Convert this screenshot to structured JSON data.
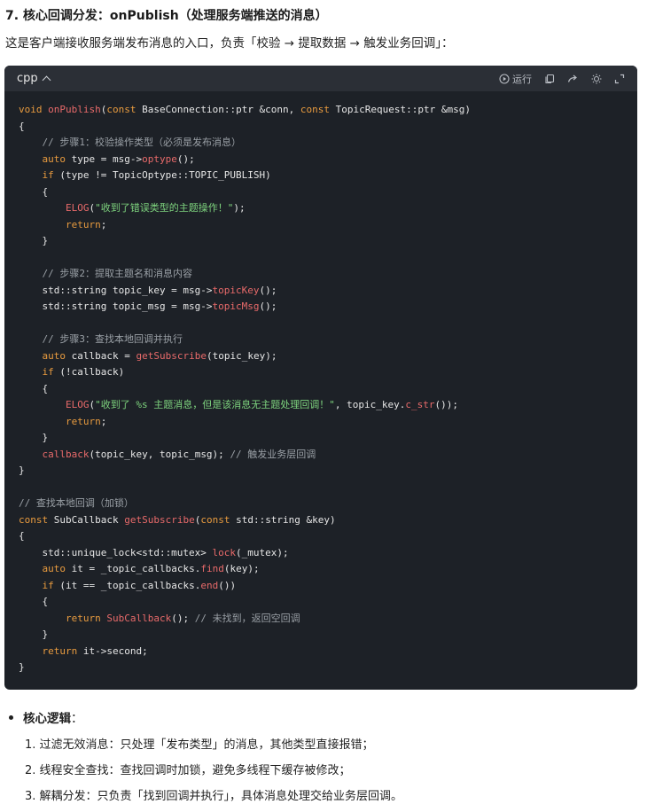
{
  "heading": "7. 核心回调分发：onPublish（处理服务端推送的消息）",
  "intro": "这是客户端接收服务端发布消息的入口，负责「校验 → 提取数据 → 触发业务回调」：",
  "code_block": {
    "language": "cpp",
    "toolbar": {
      "run_label": "运行",
      "icons": [
        "play-circle-icon",
        "copy-icon",
        "share-icon",
        "theme-icon",
        "expand-icon"
      ]
    },
    "lines": [
      "void onPublish(const BaseConnection::ptr &conn, const TopicRequest::ptr &msg)",
      "{",
      "    // 步骤1：校验操作类型（必须是发布消息）",
      "    auto type = msg->optype();",
      "    if (type != TopicOptype::TOPIC_PUBLISH)",
      "    {",
      "        ELOG(\"收到了错误类型的主题操作！\");",
      "        return;",
      "    }",
      "",
      "    // 步骤2：提取主题名和消息内容",
      "    std::string topic_key = msg->topicKey();",
      "    std::string topic_msg = msg->topicMsg();",
      "",
      "    // 步骤3：查找本地回调并执行",
      "    auto callback = getSubscribe(topic_key);",
      "    if (!callback)",
      "    {",
      "        ELOG(\"收到了 %s 主题消息，但是该消息无主题处理回调！\", topic_key.c_str());",
      "        return;",
      "    }",
      "    callback(topic_key, topic_msg); // 触发业务层回调",
      "}",
      "",
      "// 查找本地回调（加锁）",
      "const SubCallback getSubscribe(const std::string &key)",
      "{",
      "    std::unique_lock<std::mutex> lock(_mutex);",
      "    auto it = _topic_callbacks.find(key);",
      "    if (it == _topic_callbacks.end())",
      "    {",
      "        return SubCallback(); // 未找到，返回空回调",
      "    }",
      "    return it->second;",
      "}"
    ]
  },
  "core_logic": {
    "title": "核心逻辑",
    "colon": "：",
    "items": [
      "1. 过滤无效消息：只处理「发布类型」的消息，其他类型直接报错；",
      "2. 线程安全查找：查找回调时加锁，避免多线程下缓存被修改；",
      "3. 解耦分发：只负责「找到回调并执行」，具体消息处理交给业务层回调。"
    ]
  }
}
